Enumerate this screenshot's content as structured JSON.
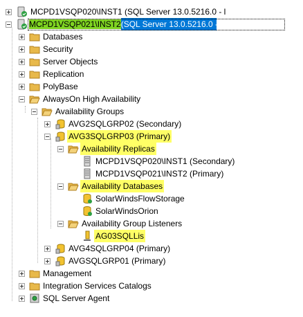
{
  "tree": {
    "server1": {
      "name": "MCPD1VSQP020\\INST1",
      "version": " (SQL Server 13.0.5216.0 - l"
    },
    "server2": {
      "name": "MCPD1VSQP021\\INST2",
      "version": " (SQL Server 13.0.5216.0 - "
    },
    "folders": {
      "databases": "Databases",
      "security": "Security",
      "server_objects": "Server Objects",
      "replication": "Replication",
      "polybase": "PolyBase",
      "alwayson": "AlwaysOn High Availability",
      "availability_groups": "Availability Groups",
      "management": "Management",
      "integration_services": "Integration Services Catalogs",
      "sql_agent": "SQL Server Agent"
    },
    "groups": {
      "avg2": "AVG2SQLGRP02 (Secondary)",
      "avg3": "AVG3SQLGRP03 (Primary)",
      "avg4": "AVG4SQLGRP04 (Primary)",
      "avg1": "AVGSQLGRP01 (Primary)"
    },
    "avg3_children": {
      "replicas_folder": "Availability Replicas",
      "replica1": "MCPD1VSQP020\\INST1 (Secondary)",
      "replica2": "MCPD1VSQP021\\INST2 (Primary)",
      "databases_folder": "Availability Databases",
      "db1": "SolarWindsFlowStorage",
      "db2": "SolarWindsOrion",
      "listeners_folder": "Availability Group Listeners",
      "listener1": "AG03SQLLis"
    }
  },
  "colors": {
    "selection": "#0078d7",
    "highlight_yellow": "#ffff66",
    "highlight_green": "#7ed321",
    "folder": "#e8b94a"
  }
}
